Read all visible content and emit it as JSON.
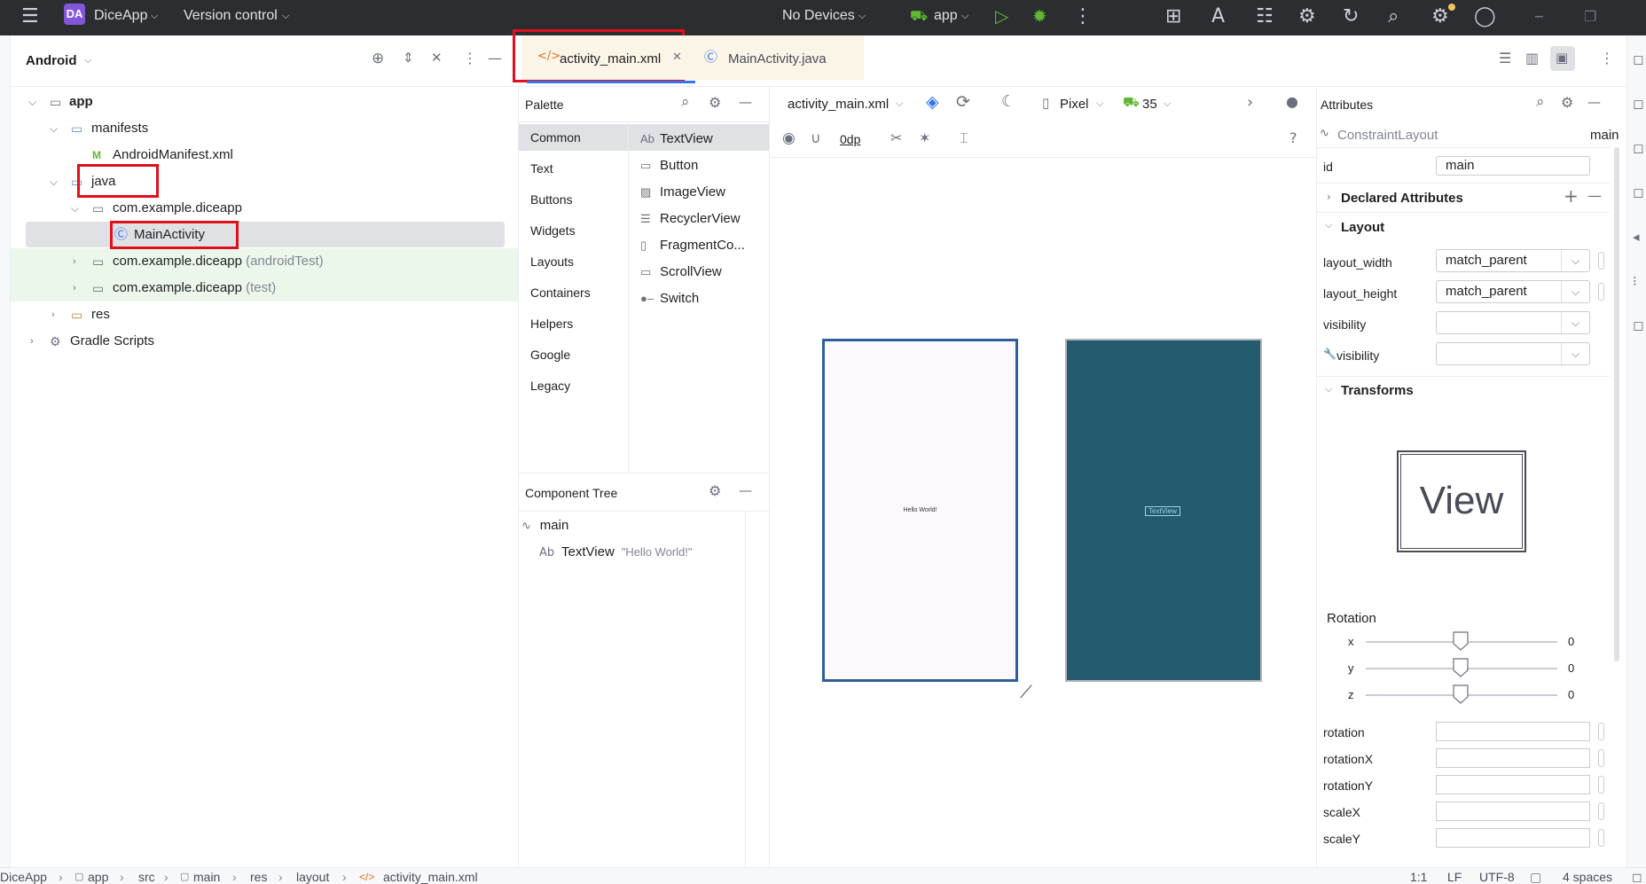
{
  "titlebar": {
    "project_badge": "DA",
    "project_name": "DiceApp",
    "vcs": "Version control",
    "devices": "No Devices",
    "run_config": "app"
  },
  "project_panel": {
    "view": "Android",
    "items": [
      {
        "label": "app",
        "bold": true
      },
      {
        "label": "manifests"
      },
      {
        "label": "AndroidManifest.xml"
      },
      {
        "label": "java"
      },
      {
        "label": "com.example.diceapp"
      },
      {
        "label": "MainActivity"
      },
      {
        "label": "com.example.diceapp",
        "suffix": "(androidTest)"
      },
      {
        "label": "com.example.diceapp",
        "suffix": "(test)"
      },
      {
        "label": "res"
      },
      {
        "label": "Gradle Scripts"
      }
    ]
  },
  "editor": {
    "tabs": [
      {
        "label": "activity_main.xml",
        "active": true
      },
      {
        "label": "MainActivity.java",
        "active": false
      }
    ],
    "file_selector": "activity_main.xml",
    "device": "Pixel",
    "api": "35",
    "margin": "0dp"
  },
  "palette": {
    "title": "Palette",
    "categories": [
      "Common",
      "Text",
      "Buttons",
      "Widgets",
      "Layouts",
      "Containers",
      "Helpers",
      "Google",
      "Legacy"
    ],
    "items": [
      {
        "label": "TextView",
        "icon": "Ab"
      },
      {
        "label": "Button",
        "icon": "button-icon"
      },
      {
        "label": "ImageView",
        "icon": "image-icon"
      },
      {
        "label": "RecyclerView",
        "icon": "list-icon"
      },
      {
        "label": "FragmentCo...",
        "icon": "fragment-icon"
      },
      {
        "label": "ScrollView",
        "icon": "scroll-icon"
      },
      {
        "label": "Switch",
        "icon": "switch-icon"
      }
    ]
  },
  "component_tree": {
    "title": "Component Tree",
    "root": "main",
    "child": "TextView",
    "child_value": "\"Hello World!\""
  },
  "design": {
    "preview_text": "Hello World!",
    "blueprint_text": "TextView",
    "blueprint_color": "#245b6e"
  },
  "attributes": {
    "title": "Attributes",
    "component": "ConstraintLayout",
    "component_id": "main",
    "id_label": "id",
    "id_value": "main",
    "declared": "Declared Attributes",
    "layout_section": "Layout",
    "layout_width_label": "layout_width",
    "layout_width": "match_parent",
    "layout_height_label": "layout_height",
    "layout_height": "match_parent",
    "visibility_label": "visibility",
    "tools_visibility_label": "visibility",
    "transforms": "Transforms",
    "view_label": "View",
    "rotation": "Rotation",
    "rot": [
      {
        "axis": "x",
        "value": "0"
      },
      {
        "axis": "y",
        "value": "0"
      },
      {
        "axis": "z",
        "value": "0"
      }
    ],
    "fields": [
      "rotation",
      "rotationX",
      "rotationY",
      "scaleX",
      "scaleY"
    ]
  },
  "statusbar": {
    "path": [
      "DiceApp",
      "app",
      "src",
      "main",
      "res",
      "layout",
      "activity_main.xml"
    ],
    "position": "1:1",
    "line_sep": "LF",
    "encoding": "UTF-8",
    "indent": "4 spaces"
  },
  "colors": {
    "accent": "#3574f0",
    "highlight": "#e00f1c",
    "test_bg": "#ebf7ea"
  }
}
